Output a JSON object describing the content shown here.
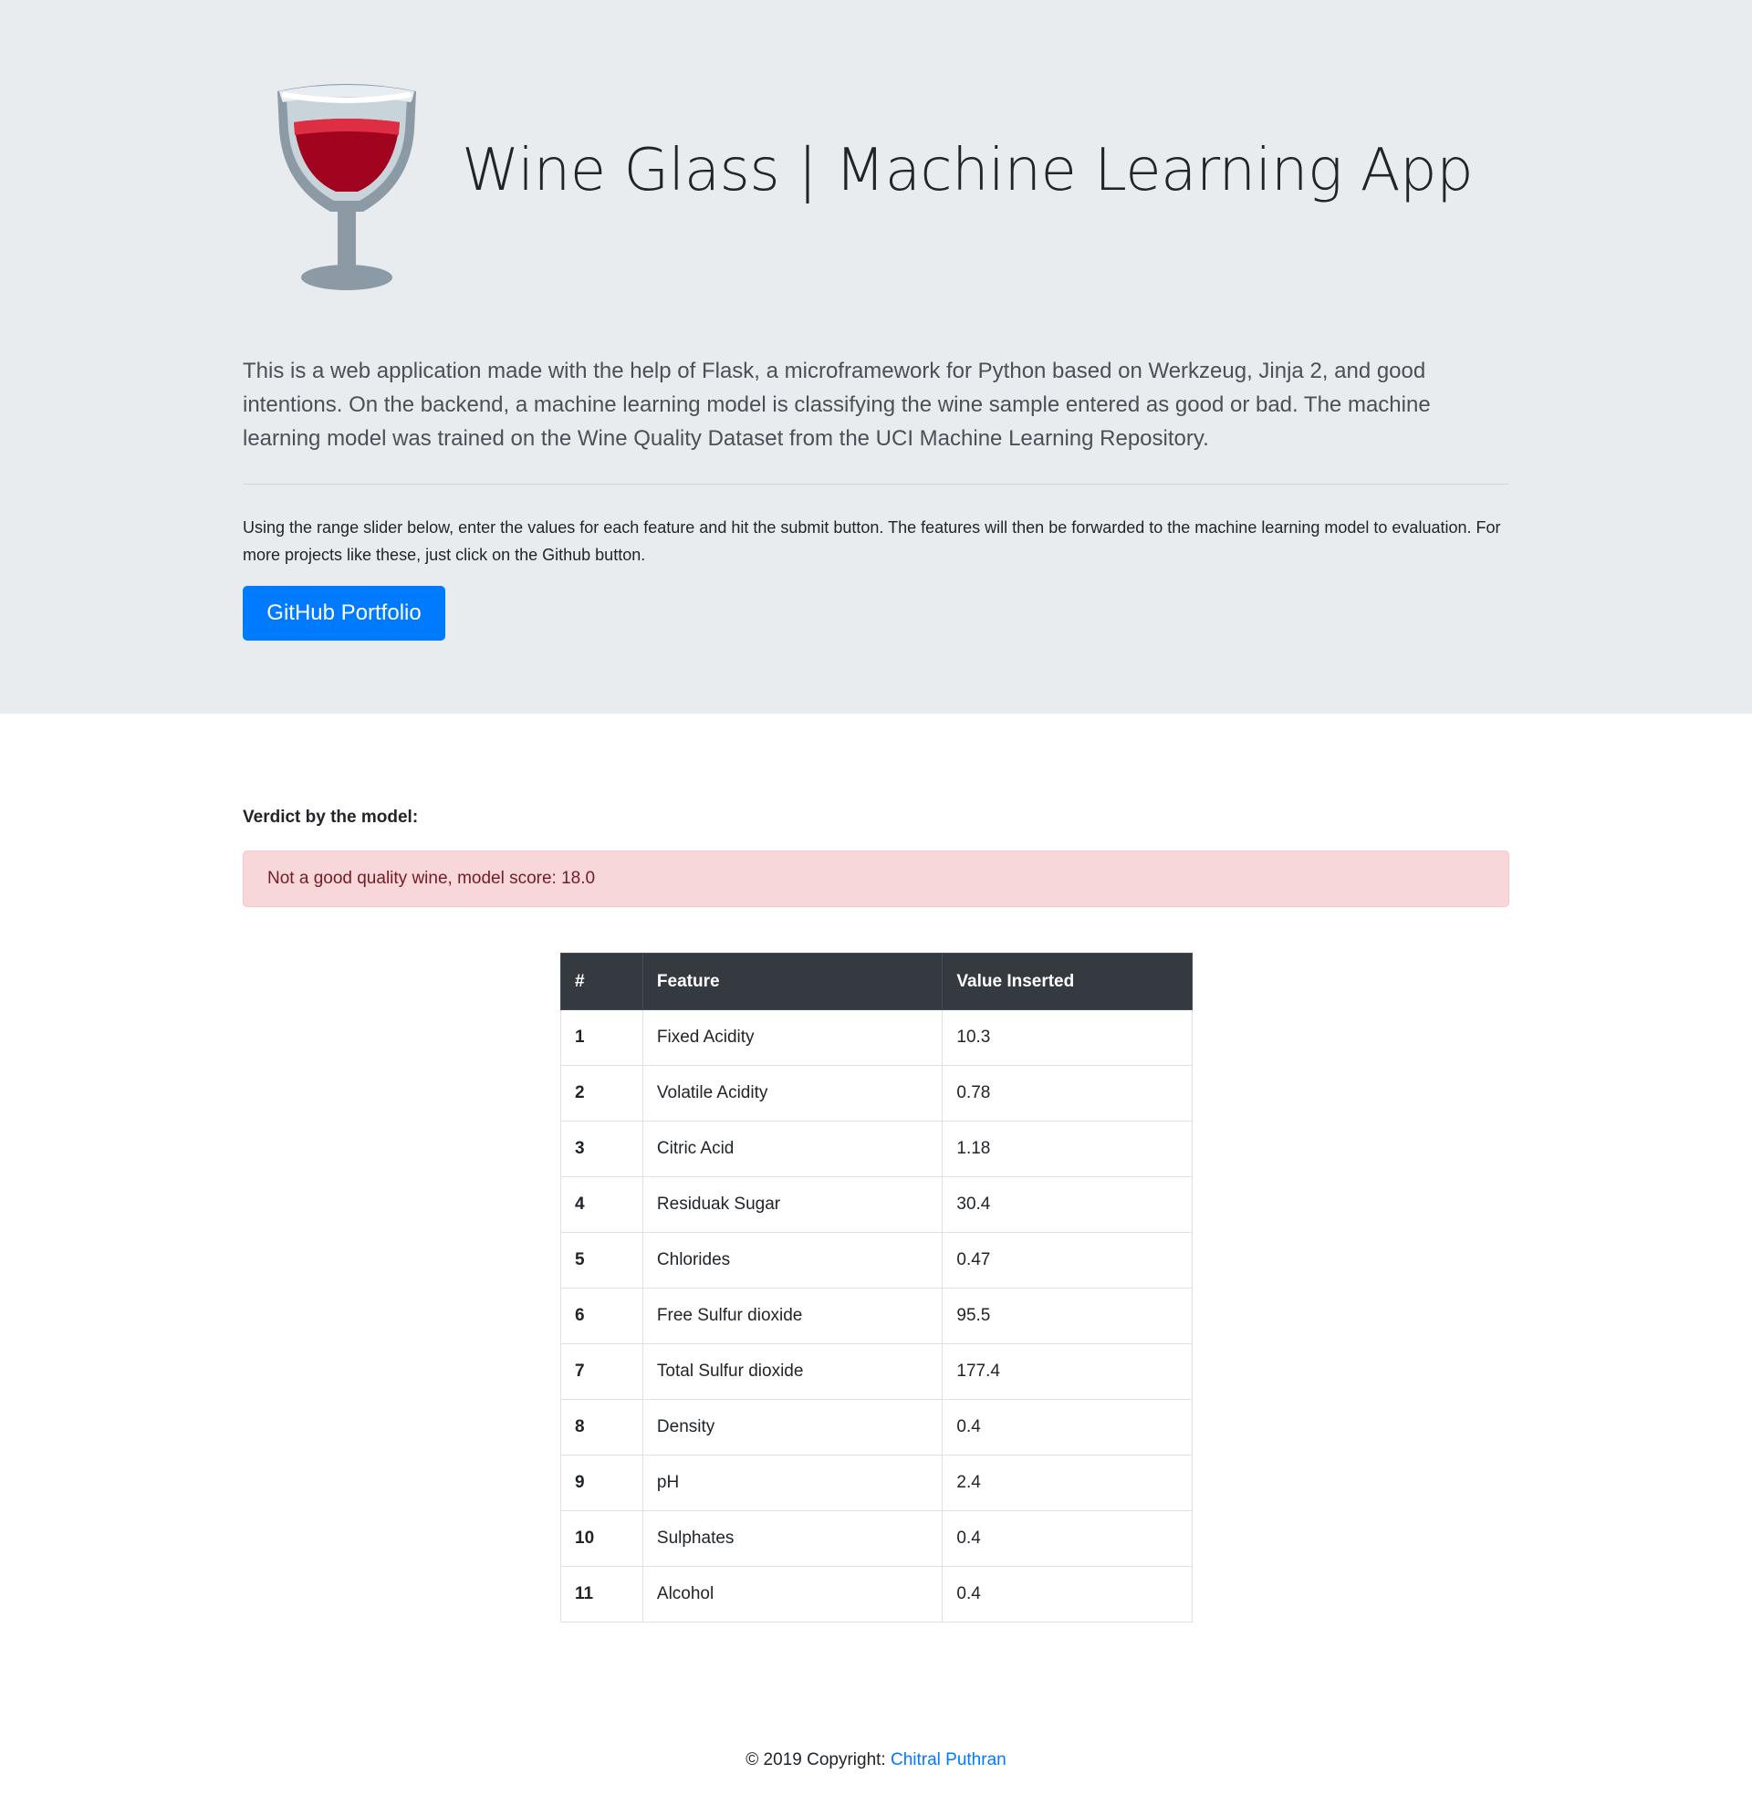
{
  "header": {
    "title": "Wine Glass | Machine Learning App",
    "description": "This is a web application made with the help of Flask, a microframework for Python based on Werkzeug, Jinja 2, and good intentions. On the backend, a machine learning model is classifying the wine sample entered as good or bad. The machine learning model was trained on the Wine Quality Dataset from the UCI Machine Learning Repository.",
    "instructions": "Using the range slider below, enter the values for each feature and hit the submit button. The features will then be forwarded to the machine learning model to evaluation. For more projects like these, just click on the Github button.",
    "github_button_label": "GitHub Portfolio",
    "logo_icon": "wine-glass-icon"
  },
  "verdict": {
    "label": "Verdict by the model:",
    "message": "Not a good quality wine, model score: 18.0",
    "status_color": "#f8d7da"
  },
  "table": {
    "headers": [
      "#",
      "Feature",
      "Value Inserted"
    ],
    "rows": [
      {
        "num": "1",
        "feature": "Fixed Acidity",
        "value": "10.3"
      },
      {
        "num": "2",
        "feature": "Volatile Acidity",
        "value": "0.78"
      },
      {
        "num": "3",
        "feature": "Citric Acid",
        "value": "1.18"
      },
      {
        "num": "4",
        "feature": "Residuak Sugar",
        "value": "30.4"
      },
      {
        "num": "5",
        "feature": "Chlorides",
        "value": "0.47"
      },
      {
        "num": "6",
        "feature": "Free Sulfur dioxide",
        "value": "95.5"
      },
      {
        "num": "7",
        "feature": "Total Sulfur dioxide",
        "value": "177.4"
      },
      {
        "num": "8",
        "feature": "Density",
        "value": "0.4"
      },
      {
        "num": "9",
        "feature": "pH",
        "value": "2.4"
      },
      {
        "num": "10",
        "feature": "Sulphates",
        "value": "0.4"
      },
      {
        "num": "11",
        "feature": "Alcohol",
        "value": "0.4"
      }
    ]
  },
  "footer": {
    "copyright": "© 2019 Copyright:",
    "author_link": "Chitral Puthran"
  },
  "colors": {
    "accent": "#007bff",
    "jumbotron_bg": "#e9ecef",
    "table_header_bg": "#343a40"
  }
}
